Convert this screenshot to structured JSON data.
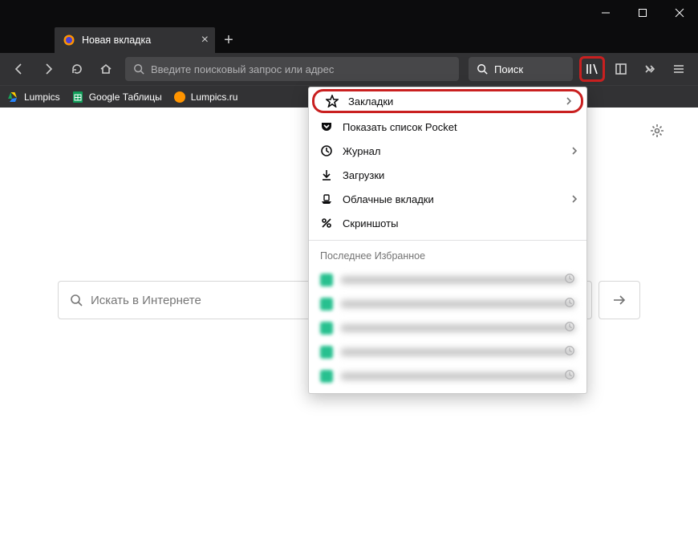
{
  "window": {
    "tab_title": "Новая вкладка"
  },
  "navbar": {
    "url_placeholder": "Введите поисковый запрос или адрес",
    "search_placeholder": "Поиск"
  },
  "bookmarks_toolbar": {
    "items": [
      {
        "label": "Lumpics",
        "favicon": "drive"
      },
      {
        "label": "Google Таблицы",
        "favicon": "sheets"
      },
      {
        "label": "Lumpics.ru",
        "favicon": "orange"
      }
    ]
  },
  "library_panel": {
    "items": [
      {
        "icon": "star",
        "label": "Закладки",
        "has_submenu": true,
        "highlighted": true
      },
      {
        "icon": "pocket",
        "label": "Показать список Pocket",
        "has_submenu": false
      },
      {
        "icon": "history",
        "label": "Журнал",
        "has_submenu": true
      },
      {
        "icon": "download",
        "label": "Загрузки",
        "has_submenu": false
      },
      {
        "icon": "cloud-tabs",
        "label": "Облачные вкладки",
        "has_submenu": true
      },
      {
        "icon": "screenshot",
        "label": "Скриншоты",
        "has_submenu": false
      }
    ],
    "recent_heading": "Последнее Избранное",
    "recent_count": 5
  },
  "content": {
    "search_placeholder": "Искать в Интернете"
  }
}
